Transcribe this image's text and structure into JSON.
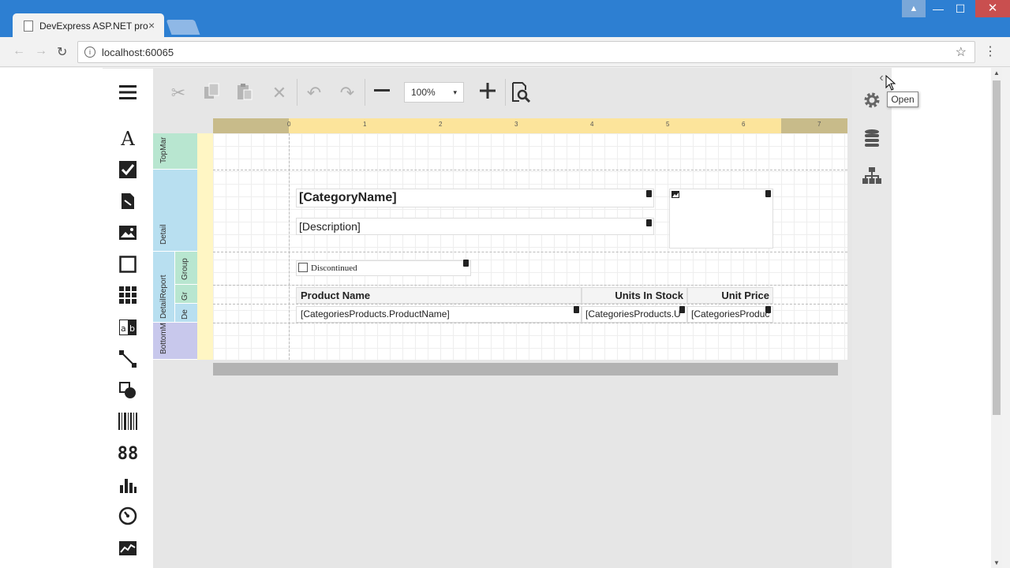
{
  "browser": {
    "tab_title": "DevExpress ASP.NET pro",
    "tab_close": "×",
    "url": "localhost:60065",
    "back": "←",
    "forward": "→",
    "reload": "↻",
    "star": "☆",
    "menu": "⋮",
    "win_min": "—",
    "win_max": "☐",
    "win_close": "✕",
    "win_user": "▲"
  },
  "designer": {
    "zoom_value": "100%",
    "zoom_arrow": "▾",
    "ruler_ticks": [
      "0",
      "1",
      "2",
      "3",
      "4",
      "5",
      "6",
      "7"
    ],
    "bands": [
      {
        "name": "TopMar",
        "color": "#b8e6d0"
      },
      {
        "name": "Detail",
        "color": "#b8dff0"
      },
      {
        "name": "DetailReport",
        "color": "#b8dff0"
      },
      {
        "name": "Group",
        "color": "#b8e6d0"
      },
      {
        "name": "Gr",
        "color": "#b8e6d0"
      },
      {
        "name": "De",
        "color": "#b8dff0"
      },
      {
        "name": "BottomM",
        "color": "#c8c8ec"
      }
    ],
    "controls": {
      "category_name": "[CategoryName]",
      "description": "[Description]",
      "discontinued": "Discontinued",
      "header_product_name": "Product Name",
      "header_units_in_stock": "Units In Stock",
      "header_unit_price": "Unit Price",
      "cell_product_name": "[CategoriesProducts.ProductName]",
      "cell_units_in_stock": "[CategoriesProducts.U",
      "cell_unit_price": "[CategoriesProduc"
    }
  },
  "right_panel": {
    "tooltip": "Open",
    "collapse_glyph": "‹"
  }
}
